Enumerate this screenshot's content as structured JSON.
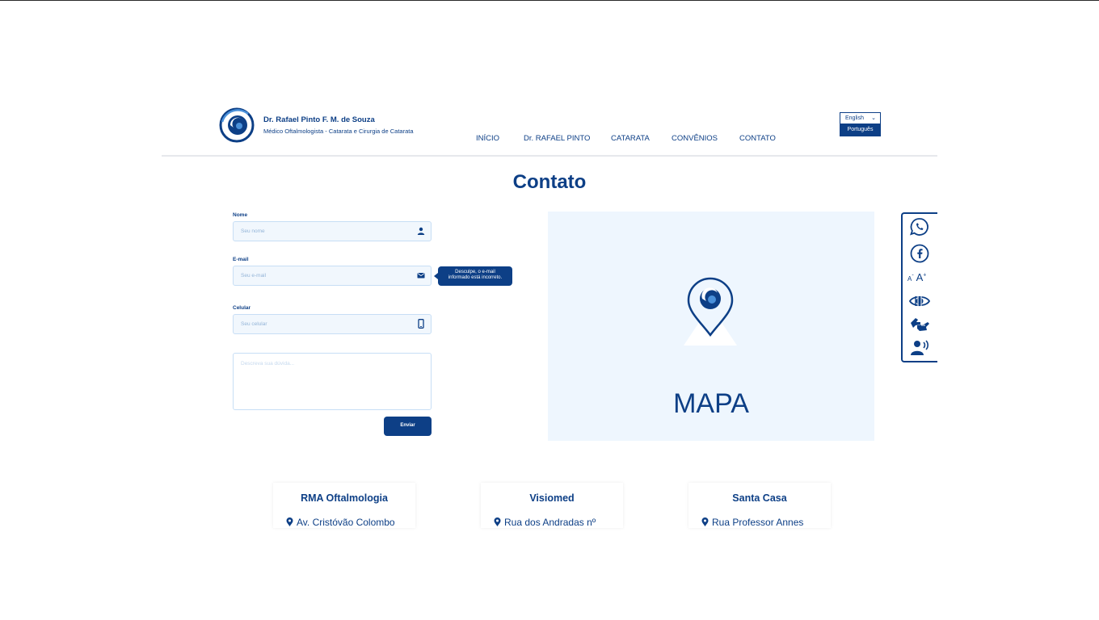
{
  "header": {
    "brand_name": "Dr. Rafael Pinto F. M. de Souza",
    "brand_subtitle": "Médico Oftalmologista - Catarata e Cirurgia de Catarata",
    "nav": [
      "INÍCIO",
      "Dr. RAFAEL PINTO",
      "CATARATA",
      "CONVÊNIOS",
      "CONTATO"
    ],
    "language": {
      "selected": "English",
      "option": "Português"
    }
  },
  "page_title": "Contato",
  "form": {
    "name_label": "Nome",
    "name_placeholder": "Seu nome",
    "email_label": "E-mail",
    "email_placeholder": "Seu e-mail",
    "email_error_line1": "Desculpe, o e-mail",
    "email_error_line2": "informado está incorreto.",
    "phone_label": "Celular",
    "phone_placeholder": "Seu celular",
    "message_placeholder": "Descreva sua dúvida...",
    "submit_label": "Enviar"
  },
  "map": {
    "label": "MAPA"
  },
  "accessibility": {
    "icons": [
      "whatsapp-icon",
      "facebook-icon",
      "font-size-icon",
      "low-vision-icon",
      "sign-language-icon",
      "screen-reader-icon"
    ],
    "font_small": "A",
    "font_small_sign": "-",
    "font_large": "A",
    "font_large_sign": "+"
  },
  "locations": [
    {
      "name": "RMA Oftalmologia",
      "address": "Av. Cristóvão Colombo"
    },
    {
      "name": "Visiomed",
      "address": "Rua dos Andradas nº"
    },
    {
      "name": "Santa Casa",
      "address": "Rua Professor Annes"
    }
  ],
  "colors": {
    "primary": "#0d3f86",
    "input_bg": "#f1f7fd",
    "map_bg": "#eef6fe"
  }
}
